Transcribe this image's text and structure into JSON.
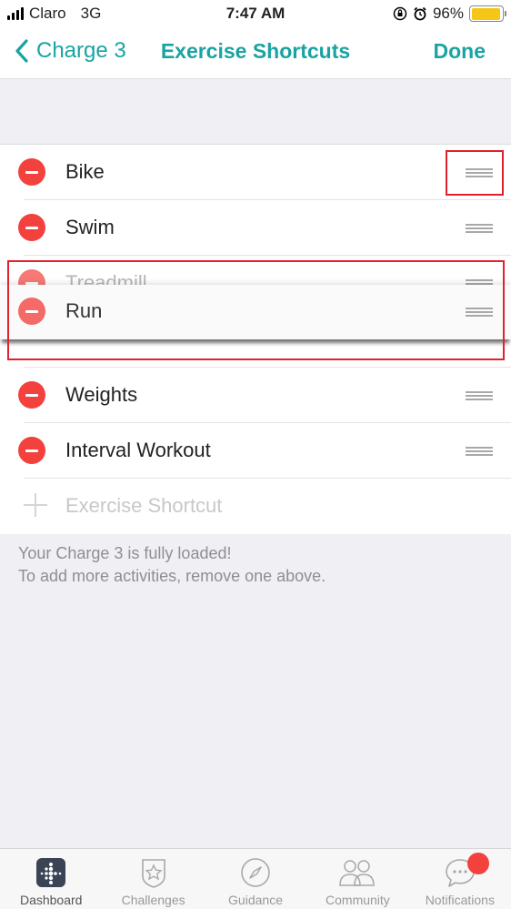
{
  "status_bar": {
    "carrier": "Claro",
    "network": "3G",
    "time": "7:47 AM",
    "battery_percent": "96%",
    "battery_level": 0.96,
    "icons": [
      "signal-icon",
      "orientation-lock-icon",
      "alarm-icon",
      "battery-icon"
    ]
  },
  "nav": {
    "back_label": "Charge 3",
    "title": "Exercise Shortcuts",
    "done_label": "Done"
  },
  "shortcuts": [
    {
      "label": "Bike"
    },
    {
      "label": "Swim"
    },
    {
      "label": "Treadmill"
    },
    {
      "label": "Run"
    },
    {
      "label": "Weights"
    },
    {
      "label": "Interval Workout"
    }
  ],
  "add_shortcut": {
    "label": "Exercise Shortcut"
  },
  "footer": {
    "line1": "Your Charge 3 is fully loaded!",
    "line2": "To add more activities, remove one above."
  },
  "tab_bar": {
    "tabs": [
      {
        "label": "Dashboard",
        "icon": "dashboard-icon",
        "active": true
      },
      {
        "label": "Challenges",
        "icon": "star-badge-icon"
      },
      {
        "label": "Guidance",
        "icon": "compass-icon"
      },
      {
        "label": "Community",
        "icon": "people-icon"
      },
      {
        "label": "Notifications",
        "icon": "chat-bubble-icon"
      }
    ]
  },
  "colors": {
    "accent": "#1aa3a3",
    "delete": "#f3413d",
    "annotation": "#e3212c"
  }
}
